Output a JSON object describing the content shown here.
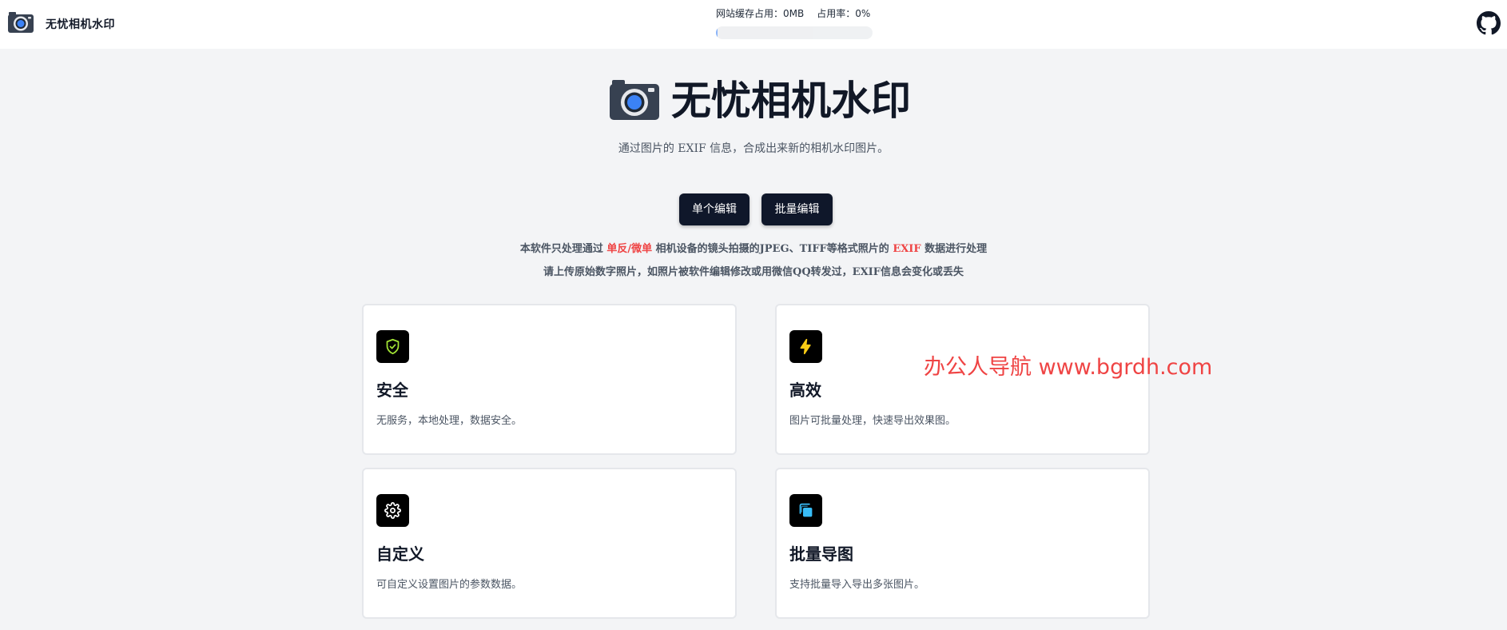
{
  "navbar": {
    "title": "无忧相机水印",
    "cache_label": "网站缓存占用：0MB",
    "usage_label": "占用率：0%",
    "usage_percent": 0
  },
  "hero": {
    "title": "无忧相机水印",
    "subtitle": "通过图片的 EXIF 信息，合成出来新的相机水印图片。"
  },
  "buttons": {
    "single_label": "单个编辑",
    "batch_label": "批量编辑"
  },
  "notice": {
    "line1_a": "本软件只处理通过 ",
    "line1_b": "单反/微单",
    "line1_c": " 相机设备的镜头拍摄的JPEG、TIFF等格式照片的 ",
    "line1_d": "EXIF",
    "line1_e": " 数据进行处理",
    "line2": "请上传原始数字照片，如照片被软件编辑修改或用微信QQ转发过，EXIF信息会变化或丢失"
  },
  "features": [
    {
      "title": "安全",
      "desc": "无服务，本地处理，数据安全。",
      "icon": "shield-check-icon"
    },
    {
      "title": "高效",
      "desc": "图片可批量处理，快速导出效果图。",
      "icon": "lightning-icon"
    },
    {
      "title": "自定义",
      "desc": "可自定义设置图片的参数数据。",
      "icon": "gear-icon"
    },
    {
      "title": "批量导图",
      "desc": "支持批量导入导出多张图片。",
      "icon": "copy-stack-icon"
    }
  ],
  "watermark": "办公人导航  www.bgrdh.com",
  "colors": {
    "accent": "#0f172a",
    "highlight": "#ef4444",
    "shield": "#a3e635",
    "bolt": "#facc15",
    "copy": "#38bdf8"
  }
}
